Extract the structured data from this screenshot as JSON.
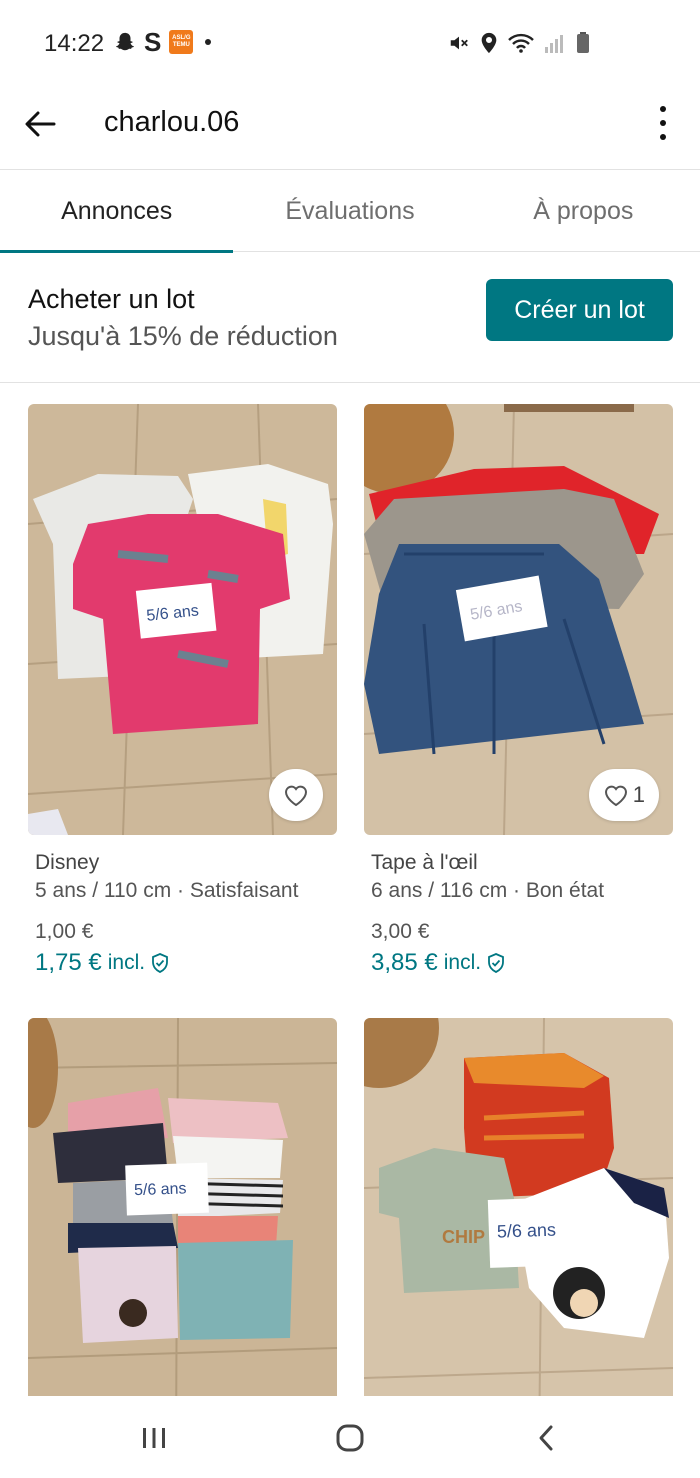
{
  "status_bar": {
    "time": "14:22",
    "left_icons": [
      "snapchat-ghost-icon",
      "s-icon",
      "temu-icon",
      "notification-dot-icon"
    ],
    "temu_label": "ASL/G TEMU",
    "right_icons": [
      "mute-icon",
      "location-icon",
      "wifi-icon",
      "signal-icon",
      "battery-icon"
    ]
  },
  "app_bar": {
    "title": "charlou.06",
    "back_icon": "arrow-left-icon",
    "menu_icon": "more-vertical-icon"
  },
  "tabs": [
    {
      "label": "Annonces",
      "active": true
    },
    {
      "label": "Évaluations",
      "active": false
    },
    {
      "label": "À propos",
      "active": false
    }
  ],
  "bundle": {
    "title": "Acheter un lot",
    "subtitle": "Jusqu'à 15% de réduction",
    "button_label": "Créer un lot"
  },
  "items": [
    {
      "brand": "Disney",
      "meta": "5 ans / 110 cm · Satisfaisant",
      "price": "1,00 €",
      "price_incl": "1,75 €",
      "incl_label": "incl.",
      "favorites": "",
      "photo_tag": "5/6 ans"
    },
    {
      "brand": "Tape à l'œil",
      "meta": "6 ans / 116 cm · Bon état",
      "price": "3,00 €",
      "price_incl": "3,85 €",
      "incl_label": "incl.",
      "favorites": "1",
      "photo_tag": "5/6 ans"
    },
    {
      "photo_tag": "5/6 ans"
    },
    {
      "photo_tag": "5/6 ans",
      "photo_print": "CHIP 'N' DALE"
    }
  ],
  "nav_bar": {
    "icons": [
      "recents-icon",
      "home-icon",
      "back-icon"
    ]
  },
  "colors": {
    "accent": "#007782",
    "text": "#111111",
    "muted": "#555555",
    "divider": "#e2e2e2"
  }
}
